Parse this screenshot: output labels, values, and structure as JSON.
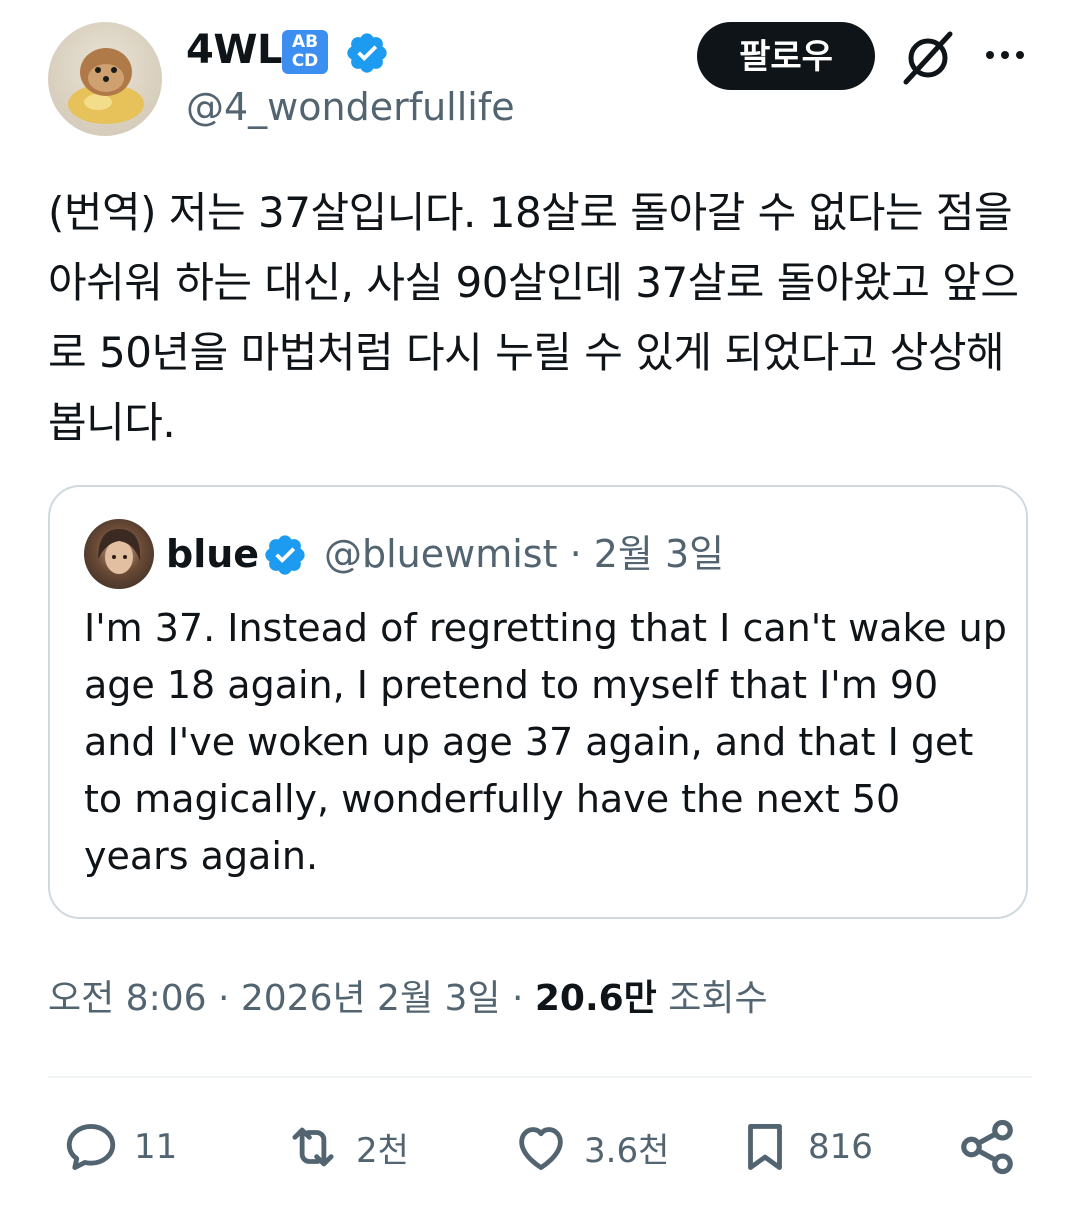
{
  "author": {
    "display_name": "4WL",
    "badge_text": "AB\nCD",
    "handle": "@4_wonderfullife",
    "follow_label": "팔로우"
  },
  "tweet": {
    "text": "(번역) 저는 37살입니다. 18살로 돌아갈 수 없다는 점을 아쉬워 하는 대신, 사실 90살인데 37살로 돌아왔고 앞으로 50년을 마법처럼 다시 누릴 수 있게 되었다고 상상해 봅니다."
  },
  "quote": {
    "name": "blue",
    "handle_date": "@bluewmist · 2월 3일",
    "text": "I'm 37. Instead of regretting that I can't wake up age 18 again, I pretend to myself that I'm 90 and I've woken up age 37 again, and that I get to magically, wonderfully have the next 50 years again."
  },
  "meta": {
    "time_date": "오전 8:06 · 2026년 2월 3일 · ",
    "views_count": "20.6만",
    "views_label": " 조회수"
  },
  "actions": {
    "replies": "11",
    "reposts": "2천",
    "likes": "3.6천",
    "bookmarks": "816"
  },
  "colors": {
    "text": "#0f1419",
    "secondary": "#536471",
    "verified": "#1d9bf0",
    "border": "#cfd9de"
  }
}
